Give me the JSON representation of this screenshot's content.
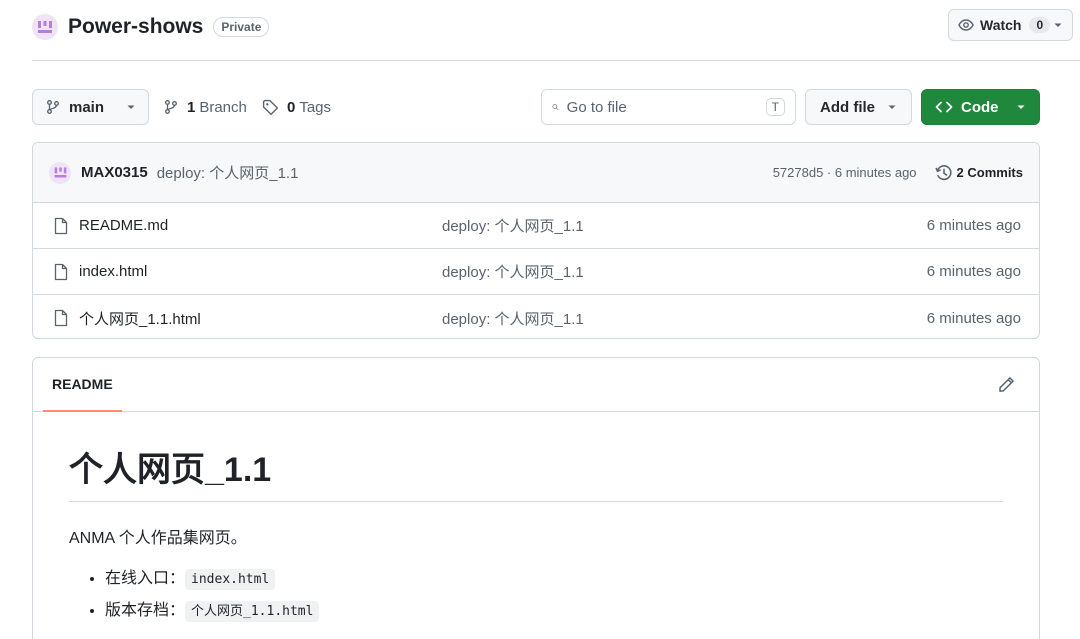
{
  "repo": {
    "name": "Power-shows",
    "visibility": "Private"
  },
  "watch": {
    "label": "Watch",
    "count": "0"
  },
  "toolbar": {
    "branch": "main",
    "branches_count": "1",
    "branches_label": "Branch",
    "tags_count": "0",
    "tags_label": "Tags",
    "search_placeholder": "Go to file",
    "search_shortcut": "T",
    "add_file_label": "Add file",
    "code_label": "Code"
  },
  "last_commit": {
    "author": "MAX0315",
    "message": "deploy: 个人网页_1.1",
    "meta": "57278d5 · 6 minutes ago",
    "commits_label": "2 Commits"
  },
  "files": [
    {
      "name": "README.md",
      "commit": "deploy: 个人网页_1.1",
      "time": "6 minutes ago"
    },
    {
      "name": "index.html",
      "commit": "deploy: 个人网页_1.1",
      "time": "6 minutes ago"
    },
    {
      "name": "个人网页_1.1.html",
      "commit": "deploy: 个人网页_1.1",
      "time": "6 minutes ago"
    }
  ],
  "readme": {
    "tab_label": "README",
    "title": "个人网页_1.1",
    "description": "ANMA 个人作品集网页。",
    "items": [
      {
        "label": "在线入口：",
        "code": "index.html"
      },
      {
        "label": "版本存档：",
        "code": "个人网页_1.1.html"
      }
    ]
  },
  "colors": {
    "accent_green": "#1f883d",
    "tab_underline": "#fd8c73",
    "avatar_bg": "#efe3f7"
  }
}
